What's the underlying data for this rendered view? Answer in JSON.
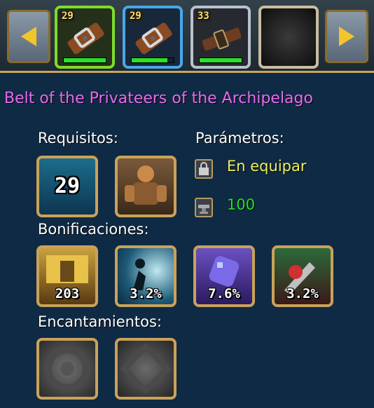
{
  "nav": {
    "slots": [
      {
        "level": "29",
        "bar_fill": 1.0
      },
      {
        "level": "29",
        "bar_fill": 0.85
      },
      {
        "level": "33",
        "bar_fill": 1.0
      },
      {
        "level": "",
        "bar_fill": 0
      }
    ]
  },
  "item": {
    "name": "Belt of the Privateers of the Archipelago"
  },
  "sections": {
    "requirements": "Requisitos:",
    "parameters": "Parámetros:",
    "bonuses": "Bonificaciones:",
    "enchantments": "Encantamientos:"
  },
  "requirements": {
    "level": "29"
  },
  "parameters": {
    "binding": "En equipar",
    "durability": "100"
  },
  "bonuses": [
    {
      "value": "203"
    },
    {
      "value": "3.2%"
    },
    {
      "value": "7.6%"
    },
    {
      "value": "3.2%"
    }
  ],
  "colors": {
    "item_name": "#e76bf0",
    "binding": "#f0f060",
    "durability": "#22e022",
    "frame_gold": "#c9a25a"
  }
}
